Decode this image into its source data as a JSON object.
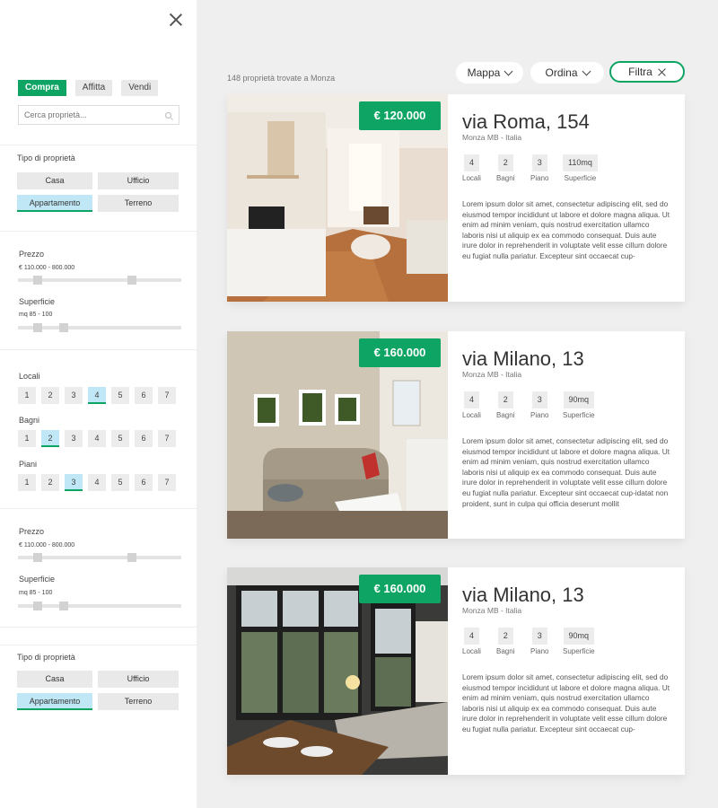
{
  "sidebar": {
    "modes": [
      "Compra",
      "Affitta",
      "Vendi"
    ],
    "search_placeholder": "Cerca proprietà...",
    "tipo_label": "Tipo di proprietà",
    "types": [
      "Casa",
      "Ufficio",
      "Appartamento",
      "Terreno"
    ],
    "prezzo_label": "Prezzo",
    "prezzo_value": "€  110.000 - 800.000",
    "superficie_label": "Superficie",
    "superficie_value": "mq  85 - 100",
    "locali_label": "Locali",
    "bagni_label": "Bagni",
    "piani_label": "Piani",
    "numbers": [
      "1",
      "2",
      "3",
      "4",
      "5",
      "6",
      "7"
    ],
    "locali_selected": "4",
    "bagni_selected": "2",
    "piani_selected": "3",
    "prezzo_slider": {
      "min_frac": 0.12,
      "max_frac": 0.7
    },
    "superficie_slider": {
      "min_frac": 0.12,
      "max_frac": 0.28
    },
    "tipo_label_2": "Tipo di proprietà"
  },
  "main": {
    "results_count": "148 proprietà trovate a Monza",
    "btn_mappa": "Mappa",
    "btn_ordina": "Ordina",
    "btn_filtra": "Filtra"
  },
  "listings": [
    {
      "price": "€ 120.000",
      "title": "via Roma, 154",
      "location": "Monza MB - Italia",
      "locali": "4",
      "bagni": "2",
      "piano": "3",
      "superficie": "110mq",
      "desc": "Lorem ipsum dolor sit amet, consectetur adipiscing elit, sed do eiusmod tempor incididunt ut labore et dolore magna aliqua. Ut enim ad minim veniam, quis nostrud exercitation ullamco laboris nisi ut aliquip ex ea commodo consequat. Duis aute irure dolor in reprehenderit in voluptate velit esse cillum dolore eu fugiat nulla pariatur. Excepteur sint occaecat cup-"
    },
    {
      "price": "€ 160.000",
      "title": "via Milano, 13",
      "location": "Monza MB - Italia",
      "locali": "4",
      "bagni": "2",
      "piano": "3",
      "superficie": "90mq",
      "desc": "Lorem ipsum dolor sit amet, consectetur adipiscing elit, sed do eiusmod tempor incididunt ut labore et dolore magna aliqua. Ut enim ad minim veniam, quis nostrud exercitation ullamco laboris nisi ut aliquip ex ea commodo consequat. Duis aute irure dolor in reprehenderit in voluptate velit esse cillum dolore eu fugiat nulla pariatur. Excepteur sint occaecat cup-idatat non proident, sunt in culpa qui officia deserunt mollit"
    },
    {
      "price": "€ 160.000",
      "title": "via Milano, 13",
      "location": "Monza MB - Italia",
      "locali": "4",
      "bagni": "2",
      "piano": "3",
      "superficie": "90mq",
      "desc": "Lorem ipsum dolor sit amet, consectetur adipiscing elit, sed do eiusmod tempor incididunt ut labore et dolore magna aliqua. Ut enim ad minim veniam, quis nostrud exercitation ullamco laboris nisi ut aliquip ex ea commodo consequat. Duis aute irure dolor in reprehenderit in voluptate velit esse cillum dolore eu fugiat nulla pariatur. Excepteur sint occaecat cup-"
    }
  ],
  "feature_labels": {
    "locali": "Locali",
    "bagni": "Bagni",
    "piano": "Piano",
    "superficie": "Superficie"
  }
}
